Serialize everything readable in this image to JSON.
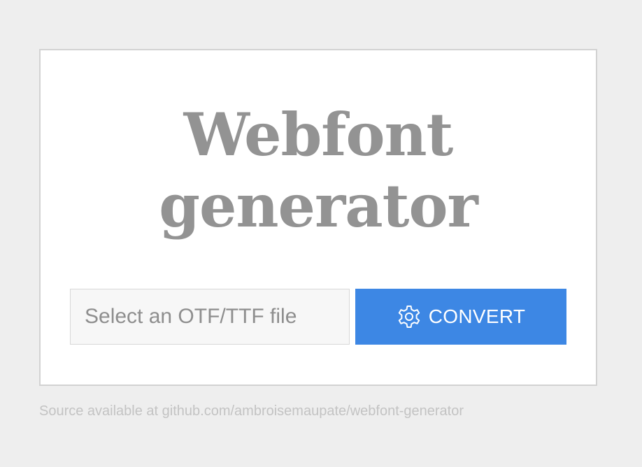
{
  "app": {
    "title_line1": "Webfont",
    "title_line2": "generator"
  },
  "form": {
    "file_input": {
      "placeholder": "Select an OTF/TTF file",
      "value": ""
    },
    "convert_button": {
      "label": "CONVERT",
      "icon": "gear-icon"
    }
  },
  "footer": {
    "source_text": "Source available at github.com/ambroisemaupate/webfont-generator"
  },
  "colors": {
    "page_background": "#eeeeee",
    "card_background": "#ffffff",
    "card_border": "#d2d2d2",
    "title_text": "#939393",
    "input_background": "#f7f7f7",
    "input_placeholder": "#8e8e8e",
    "button_background": "#3d87e4",
    "button_text": "#ffffff",
    "footer_text": "#c3c3c3"
  }
}
